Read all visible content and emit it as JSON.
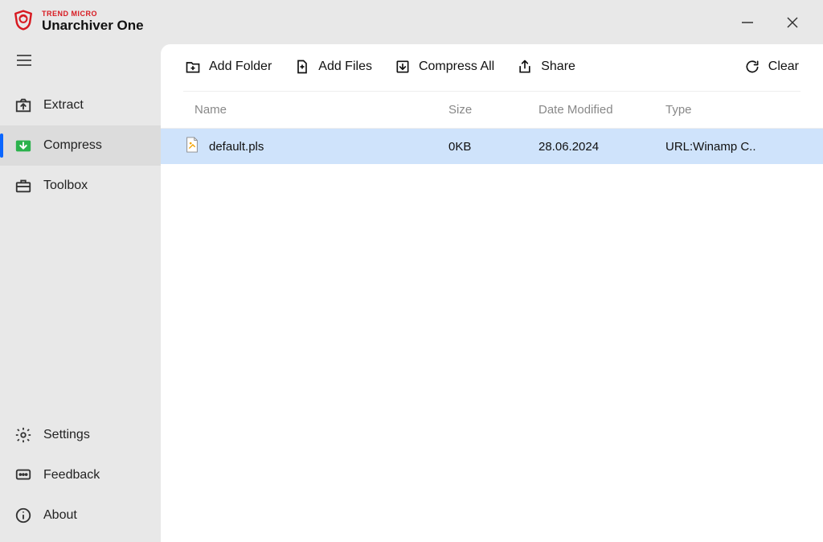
{
  "brand": {
    "line1": "TREND MICRO",
    "line2": "Unarchiver One"
  },
  "sidebar": {
    "items": [
      {
        "label": "Extract"
      },
      {
        "label": "Compress"
      },
      {
        "label": "Toolbox"
      }
    ],
    "bottom": [
      {
        "label": "Settings"
      },
      {
        "label": "Feedback"
      },
      {
        "label": "About"
      }
    ]
  },
  "toolbar": {
    "add_folder": "Add Folder",
    "add_files": "Add Files",
    "compress_all": "Compress All",
    "share": "Share",
    "clear": "Clear"
  },
  "table": {
    "headers": {
      "name": "Name",
      "size": "Size",
      "date": "Date Modified",
      "type": "Type"
    },
    "rows": [
      {
        "name": "default.pls",
        "size": "0KB",
        "date": "28.06.2024",
        "type": "URL:Winamp C.."
      }
    ]
  }
}
